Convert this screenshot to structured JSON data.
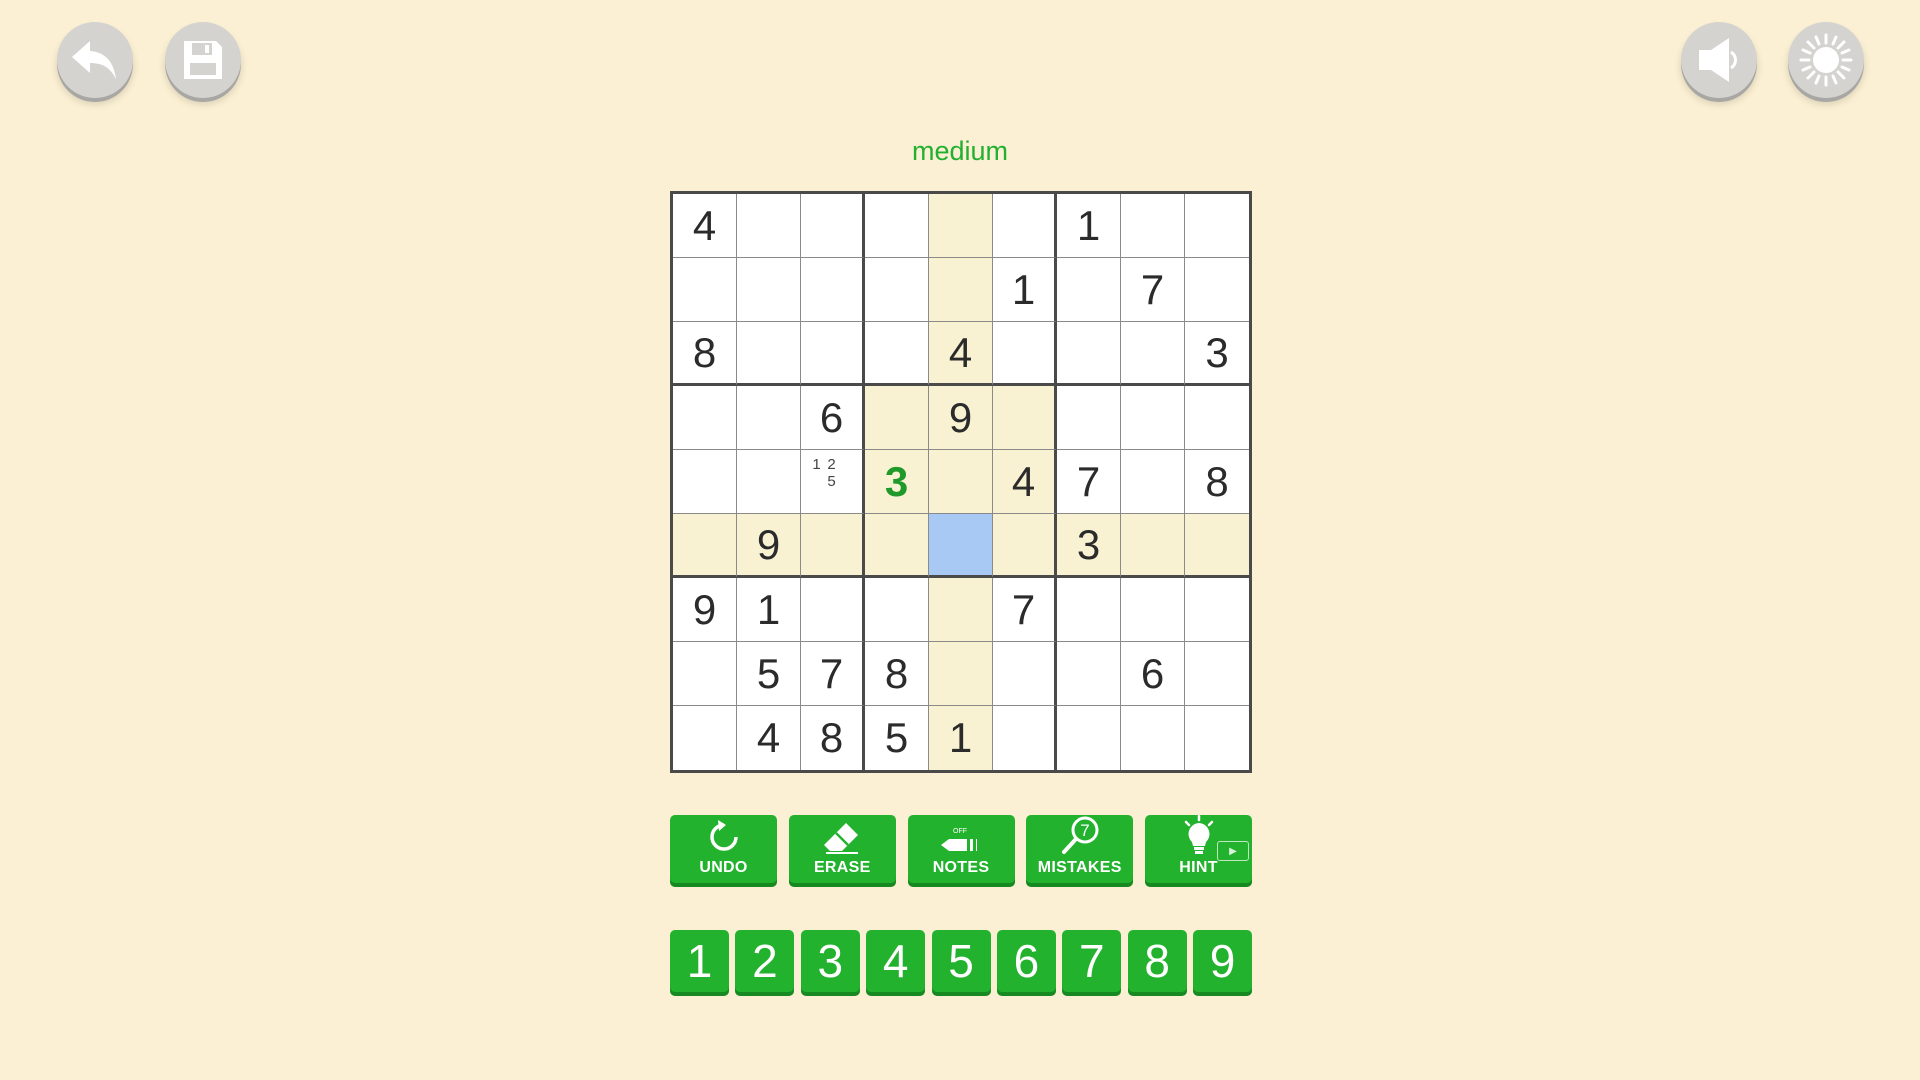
{
  "header": {
    "back_icon": "back-arrow-icon",
    "save_icon": "floppy-disk-icon",
    "sound_icon": "speaker-icon",
    "theme_icon": "sun-icon"
  },
  "difficulty": "medium",
  "board": {
    "selected": [
      5,
      4
    ],
    "rows": [
      [
        "4",
        "",
        "",
        "",
        "",
        "",
        "1",
        "",
        ""
      ],
      [
        "",
        "",
        "",
        "",
        "",
        "1",
        "",
        "7",
        ""
      ],
      [
        "8",
        "",
        "",
        "",
        "4",
        "",
        "",
        "",
        "3"
      ],
      [
        "",
        "",
        "6",
        "",
        "9",
        "",
        "",
        "",
        ""
      ],
      [
        "",
        "",
        "",
        "3",
        "",
        "4",
        "7",
        "",
        "8"
      ],
      [
        "",
        "9",
        "",
        "",
        "",
        "",
        "3",
        "",
        ""
      ],
      [
        "9",
        "1",
        "",
        "",
        "",
        "7",
        "",
        "",
        ""
      ],
      [
        "",
        "5",
        "7",
        "8",
        "",
        "",
        "",
        "6",
        ""
      ],
      [
        "",
        "4",
        "8",
        "5",
        "1",
        "",
        "",
        "",
        ""
      ]
    ],
    "user_entries": [
      [
        4,
        3
      ]
    ],
    "notes": [
      {
        "row": 4,
        "col": 2,
        "marks": [
          "1",
          "2",
          "",
          "",
          "5",
          "",
          "",
          "",
          ""
        ]
      }
    ]
  },
  "tools": [
    {
      "id": "undo",
      "label": "UNDO",
      "icon": "undo-icon"
    },
    {
      "id": "erase",
      "label": "ERASE",
      "icon": "eraser-icon"
    },
    {
      "id": "notes",
      "label": "NOTES",
      "icon": "pencil-icon",
      "state_text": "OFF"
    },
    {
      "id": "mistakes",
      "label": "MISTAKES",
      "icon": "magnifier-icon",
      "count": "7"
    },
    {
      "id": "hint",
      "label": "HINT",
      "icon": "lightbulb-icon",
      "badge": "▶"
    }
  ],
  "numbers": [
    "1",
    "2",
    "3",
    "4",
    "5",
    "6",
    "7",
    "8",
    "9"
  ],
  "colors": {
    "background": "#fbf0d3",
    "accent_green": "#23b22e",
    "highlight": "#f9f2d2",
    "selected": "#a7c9f3",
    "difficulty_text": "#22b030"
  }
}
